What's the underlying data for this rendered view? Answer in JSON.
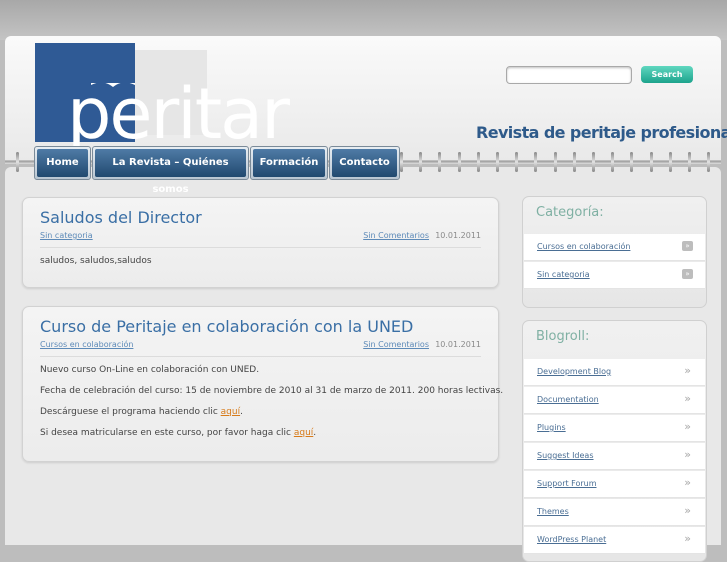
{
  "header": {
    "logo_text": "peritar",
    "tagline": "Revista de peritaje profesional",
    "search": {
      "placeholder": "",
      "value": "",
      "button_label": "Search"
    }
  },
  "nav": {
    "items": [
      {
        "label": "Home"
      },
      {
        "label": "La Revista – Quiénes somos"
      },
      {
        "label": "Formación"
      },
      {
        "label": "Contacto"
      }
    ]
  },
  "posts": [
    {
      "title": "Saludos del Director",
      "category": "Sin categoria",
      "comments": "Sin Comentarios",
      "date": "10.01.2011",
      "body": [
        "saludos, saludos,saludos"
      ]
    },
    {
      "title": "Curso de Peritaje en colaboración con la UNED",
      "category": "Cursos en colaboración",
      "comments": "Sin Comentarios",
      "date": "10.01.2011",
      "body": [
        "Nuevo curso On-Line en colaboración con UNED.",
        "Fecha de celebración del curso: 15 de noviembre de 2010 al 31 de marzo de 2011. 200 horas lectivas."
      ],
      "download": {
        "prefix": "Descárguese el programa haciendo clic ",
        "link": "aquí",
        "suffix": "."
      },
      "enroll": {
        "prefix": "Si desea matricularse en este curso, por favor haga clic ",
        "link": "aquí",
        "suffix": "."
      }
    }
  ],
  "sidebar": {
    "categories": {
      "title": "Categoría:",
      "items": [
        {
          "label": "Cursos en colaboración"
        },
        {
          "label": "Sin categoria"
        }
      ]
    },
    "blogroll": {
      "title": "Blogroll:",
      "items": [
        {
          "label": "Development Blog"
        },
        {
          "label": "Documentation"
        },
        {
          "label": "Plugins"
        },
        {
          "label": "Suggest Ideas"
        },
        {
          "label": "Support Forum"
        },
        {
          "label": "Themes"
        },
        {
          "label": "WordPress Planet"
        }
      ]
    }
  },
  "colors": {
    "brand_blue": "#2f5a95",
    "nav_blue": "#2a5580",
    "link_orange": "#d77b1a",
    "search_button": "#2bbfa4",
    "widget_title": "#7fb0a3"
  },
  "icons": {
    "category_item": "arrow-box-icon",
    "blogroll_item": "double-chevron-icon"
  }
}
